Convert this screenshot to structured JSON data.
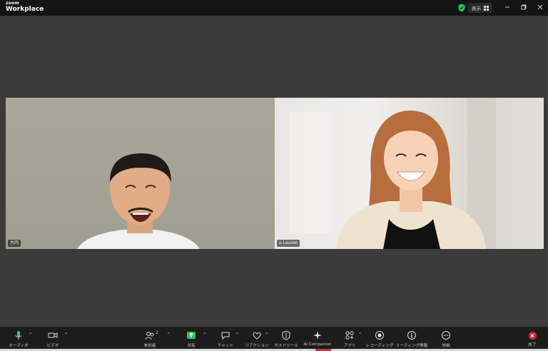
{
  "app": {
    "brand_small": "zoom",
    "brand_big": "Workplace"
  },
  "titlebar": {
    "view_label": "表示",
    "icons": [
      "shield-check-icon",
      "grid-icon",
      "minimize-icon",
      "restore-icon",
      "close-icon"
    ]
  },
  "participants": [
    {
      "name": "大内"
    },
    {
      "name": "Lauren",
      "name_prefix_icon": "pronoun-icon"
    }
  ],
  "toolbar": {
    "audio_label": "オーディオ",
    "video_label": "ビデオ",
    "participants_label": "参加者",
    "participants_count": "2",
    "share_label": "共有",
    "chat_label": "チャット",
    "reactions_label": "リアクション",
    "host_tools_label": "ホストツール",
    "ai_companion_label": "AI Companion",
    "apps_label": "アプリ",
    "recording_label": "レコーディング",
    "meeting_info_label": "ミーティング情報",
    "more_label": "詳細",
    "end_label": "終了"
  },
  "colors": {
    "background": "#3b3b3b",
    "titlebar": "#141414",
    "toolbar": "#1c1c1c",
    "share_green": "#22c55e",
    "mic_green": "#2ecc71",
    "end_red": "#cc2b3a",
    "shield_green": "#22c55e"
  }
}
